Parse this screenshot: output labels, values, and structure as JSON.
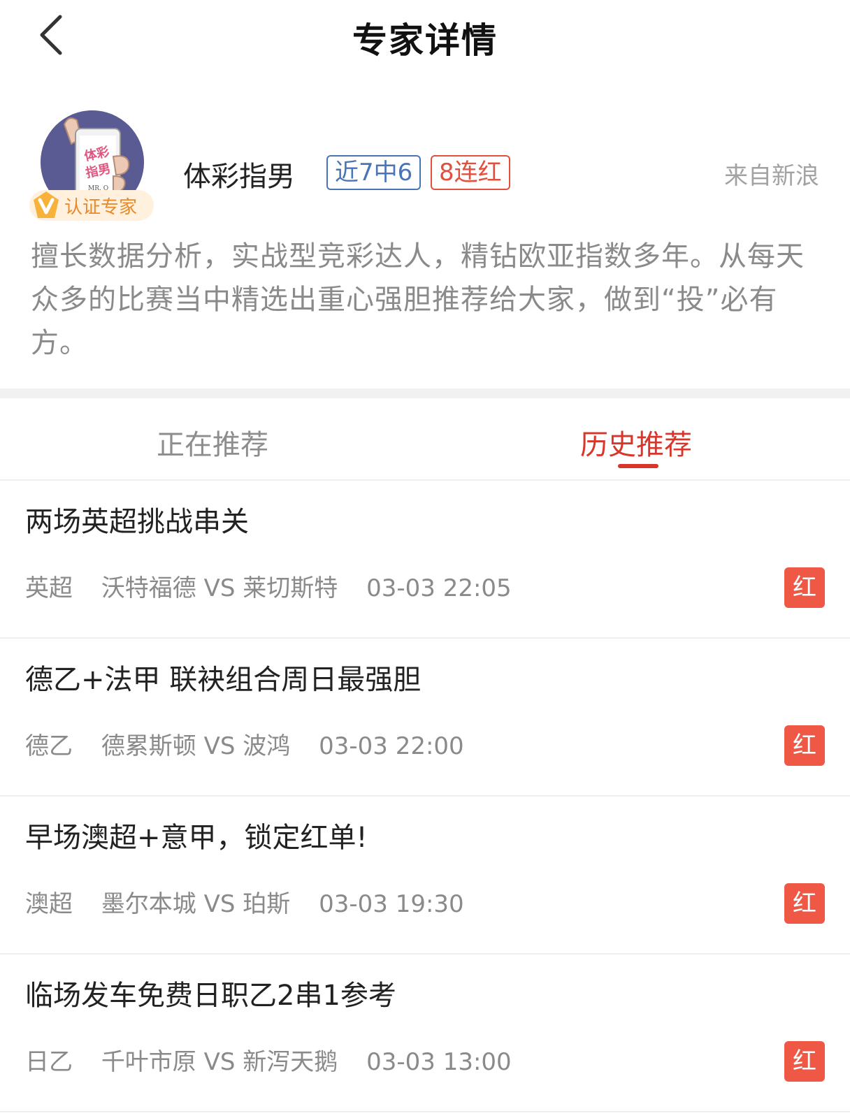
{
  "header": {
    "title": "专家详情"
  },
  "profile": {
    "name": "体彩指男",
    "verify_label": "认证专家",
    "avatar_text_1": "体彩",
    "avatar_text_2": "指男",
    "avatar_text_3": "MR. O",
    "tag_recent": "近7中6",
    "tag_streak": "8连红",
    "source": "来自新浪",
    "bio": "擅长数据分析，实战型竞彩达人，精钻欧亚指数多年。从每天众多的比赛当中精选出重心强胆推荐给大家，做到“投”必有方。"
  },
  "tabs": {
    "current": "正在推荐",
    "history": "历史推荐"
  },
  "recommendations": [
    {
      "title": "两场英超挑战串关",
      "league": "英超",
      "match": "沃特福德 VS 莱切斯特",
      "time": "03-03 22:05",
      "result": "红"
    },
    {
      "title": "德乙+法甲 联袂组合周日最强胆",
      "league": "德乙",
      "match": "德累斯顿 VS 波鸿",
      "time": "03-03 22:00",
      "result": "红"
    },
    {
      "title": "早场澳超+意甲，锁定红单!",
      "league": "澳超",
      "match": "墨尔本城 VS 珀斯",
      "time": "03-03 19:30",
      "result": "红"
    },
    {
      "title": "临场发车免费日职乙2串1参考",
      "league": "日乙",
      "match": "千叶市原 VS 新泻天鹅",
      "time": "03-03 13:00",
      "result": "红"
    }
  ]
}
